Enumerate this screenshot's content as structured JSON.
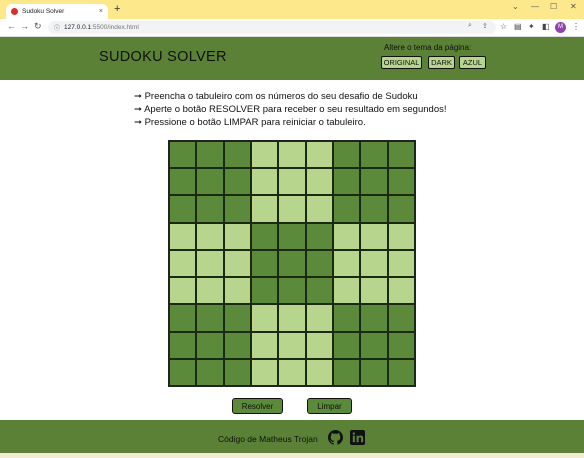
{
  "browser": {
    "tab_title": "Sudoku Solver",
    "tab_close": "×",
    "new_tab": "+",
    "url_host": "127.0.0.1",
    "url_path": ":5500/index.html",
    "window_controls": [
      "⌄",
      "—",
      "☐",
      "✕"
    ],
    "nav": {
      "back": "←",
      "forward": "→",
      "reload": "↻"
    },
    "profile_initial": "M"
  },
  "header": {
    "title": "SUDOKU SOLVER",
    "theme_label": "Altere o tema da página:",
    "theme_buttons": [
      "ORIGINAL",
      "DARK",
      "AZUL"
    ]
  },
  "instructions": [
    "➞ Preencha o tabuleiro com os números do seu desafio de Sudoku",
    "➞ Aperte o botão RESOLVER para receber o seu resultado em segundos!",
    "➞ Pressione o botão LIMPAR para reiniciar o tabuleiro."
  ],
  "board": {
    "rows": 9,
    "cols": 9,
    "colors": {
      "dark": "#5a8a3a",
      "light": "#b8d58e"
    },
    "cells": [
      [
        "",
        "",
        "",
        "",
        "",
        "",
        "",
        "",
        ""
      ],
      [
        "",
        "",
        "",
        "",
        "",
        "",
        "",
        "",
        ""
      ],
      [
        "",
        "",
        "",
        "",
        "",
        "",
        "",
        "",
        ""
      ],
      [
        "",
        "",
        "",
        "",
        "",
        "",
        "",
        "",
        ""
      ],
      [
        "",
        "",
        "",
        "",
        "",
        "",
        "",
        "",
        ""
      ],
      [
        "",
        "",
        "",
        "",
        "",
        "",
        "",
        "",
        ""
      ],
      [
        "",
        "",
        "",
        "",
        "",
        "",
        "",
        "",
        ""
      ],
      [
        "",
        "",
        "",
        "",
        "",
        "",
        "",
        "",
        ""
      ],
      [
        "",
        "",
        "",
        "",
        "",
        "",
        "",
        "",
        ""
      ]
    ]
  },
  "actions": {
    "solve_label": "Resolver",
    "clear_label": "Limpar"
  },
  "footer": {
    "credit": "Código de Matheus Trojan",
    "icons": [
      "github-icon",
      "linkedin-icon"
    ]
  },
  "colors": {
    "header_bg": "#5a8136",
    "button_light": "#b8d58e",
    "button_dark": "#5a8a3a",
    "chrome": "#fde98c"
  }
}
